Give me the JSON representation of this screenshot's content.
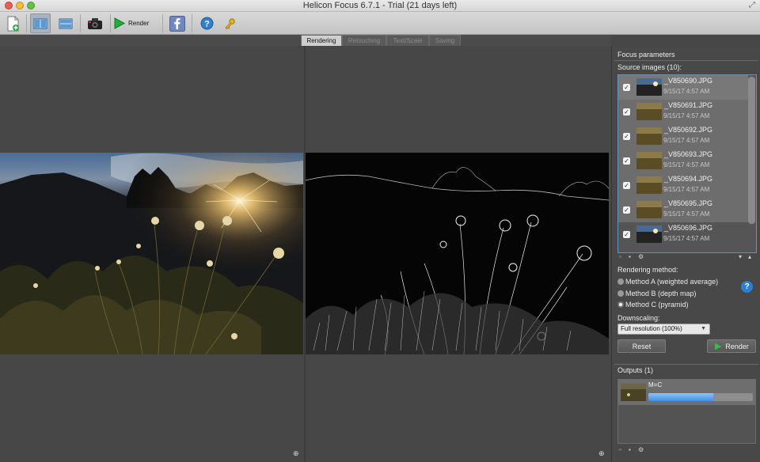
{
  "window": {
    "title": "Helicon Focus 6.7.1 - Trial (21 days left)"
  },
  "toolbar": {
    "render_label": "Render"
  },
  "tabs": [
    {
      "label": "Rendering",
      "active": true
    },
    {
      "label": "Retouching",
      "active": false
    },
    {
      "label": "Text/Scale",
      "active": false
    },
    {
      "label": "Saving",
      "active": false
    }
  ],
  "panel": {
    "title": "Focus parameters",
    "source_label": "Source images (10):",
    "source_images": [
      {
        "name": "_V850690.JPG",
        "date": "9/15/17 4:57 AM",
        "checked": true
      },
      {
        "name": "_V850691.JPG",
        "date": "9/15/17 4:57 AM",
        "checked": true
      },
      {
        "name": "_V850692.JPG",
        "date": "9/15/17 4:57 AM",
        "checked": true
      },
      {
        "name": "_V850693.JPG",
        "date": "9/15/17 4:57 AM",
        "checked": true
      },
      {
        "name": "_V850694.JPG",
        "date": "9/15/17 4:57 AM",
        "checked": true
      },
      {
        "name": "_V850695.JPG",
        "date": "9/15/17 4:57 AM",
        "checked": true
      },
      {
        "name": "_V850696.JPG",
        "date": "9/15/17 4:57 AM",
        "checked": true
      }
    ],
    "method_label": "Rendering method:",
    "methods": [
      {
        "label": "Method A (weighted average)",
        "selected": false
      },
      {
        "label": "Method B (depth map)",
        "selected": false
      },
      {
        "label": "Method C (pyramid)",
        "selected": true
      }
    ],
    "downscaling_label": "Downscaling:",
    "downscaling_value": "Full resolution (100%)",
    "reset_label": "Reset",
    "render_label": "Render",
    "outputs_label": "Outputs (1)",
    "output": {
      "name": "M=C",
      "progress": 0.62
    }
  },
  "colors": {
    "accent": "#3f8fe0",
    "render_green": "#1fae3a",
    "help_blue": "#2f7fd0"
  }
}
